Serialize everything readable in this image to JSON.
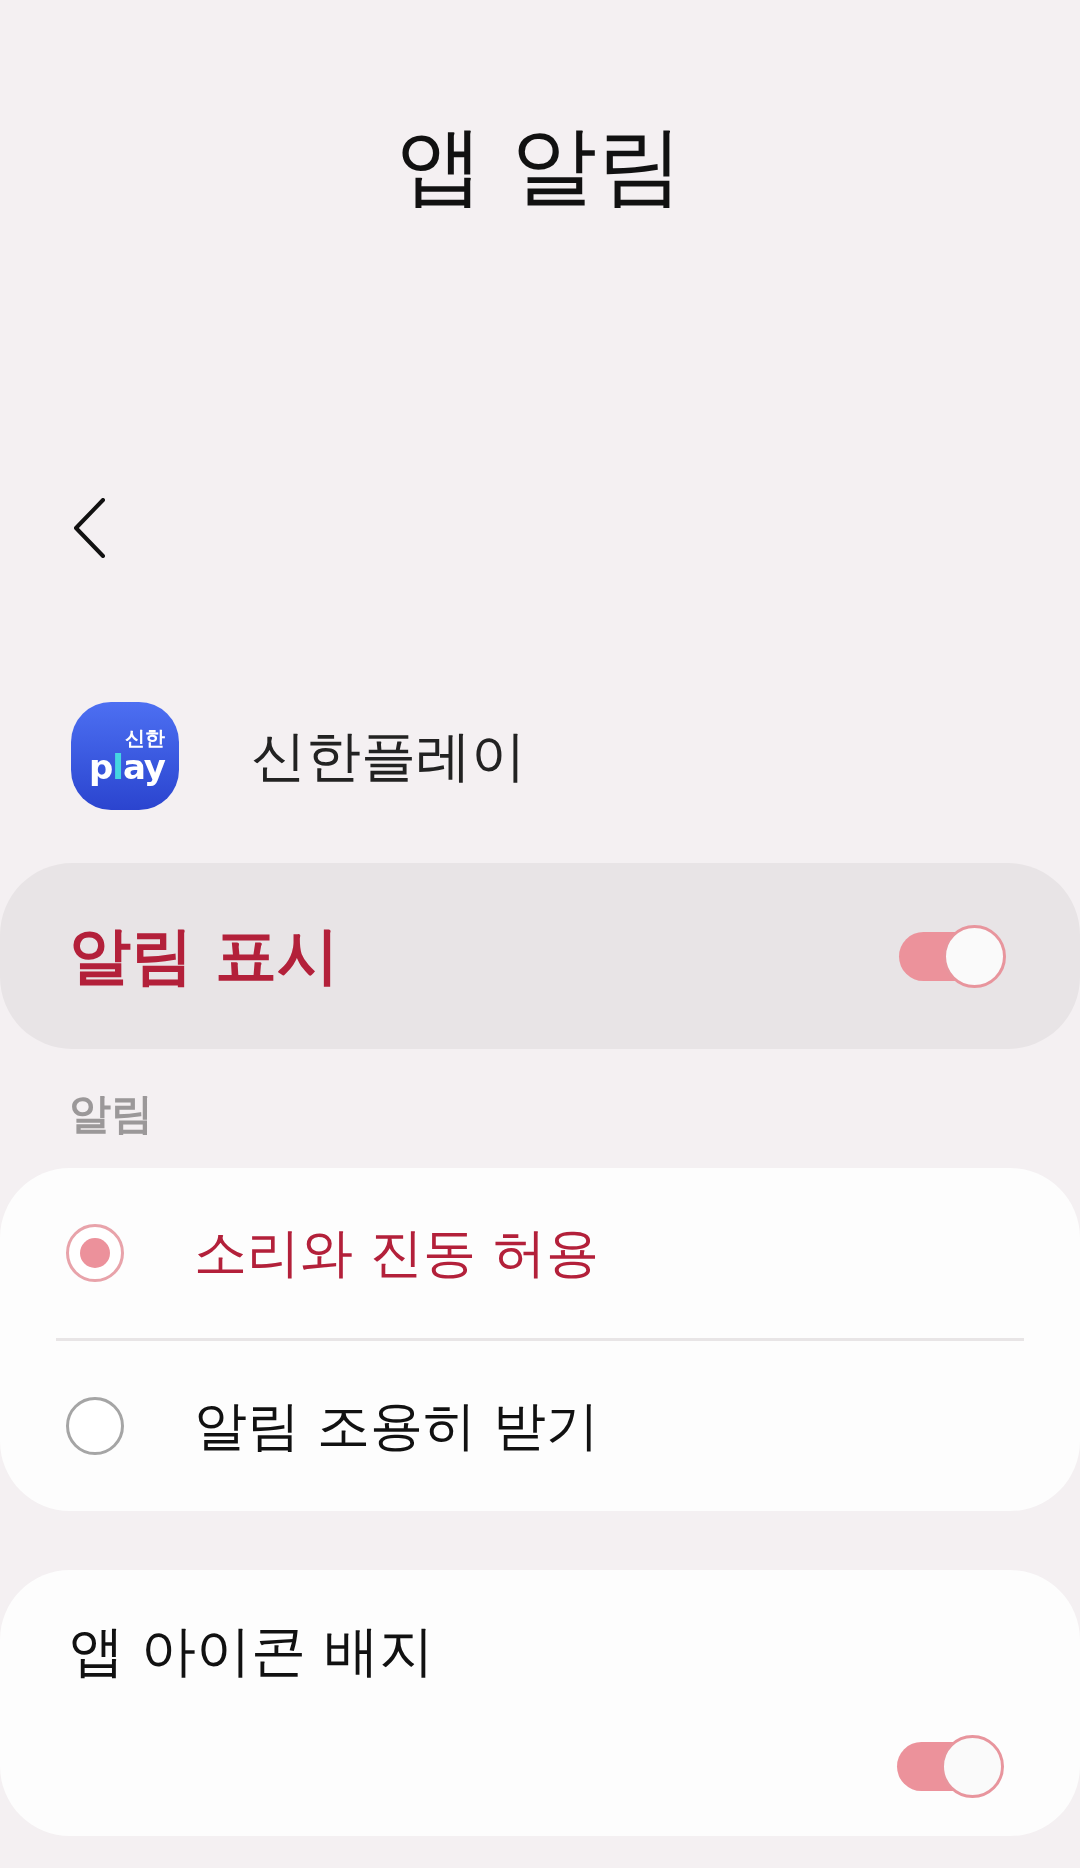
{
  "header": {
    "title": "앱 알림"
  },
  "app": {
    "name": "신한플레이",
    "logo_caption": "신한",
    "logo_wordmark": "play"
  },
  "master_switch": {
    "label": "알림 표시",
    "on": true
  },
  "section_label": "알림",
  "alert_options": [
    {
      "label": "소리와 진동 허용",
      "selected": true
    },
    {
      "label": "알림 조용히 받기",
      "selected": false
    }
  ],
  "badge_setting": {
    "label": "앱 아이콘 배지",
    "on": true
  }
}
